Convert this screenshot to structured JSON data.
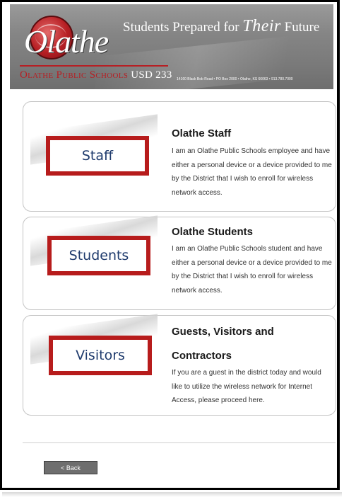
{
  "header": {
    "tagline_prefix": "Students Prepared for ",
    "tagline_script": "Their",
    "tagline_suffix": " Future",
    "logo_script": "Olathe",
    "logo_name_first": "Olathe Public Schools",
    "logo_name_second": " USD 233",
    "address": "14160 Black Bob Road • PO Box 2000 • Olathe, KS 66063 • 913.780.7000"
  },
  "options": [
    {
      "button_label": "Staff",
      "title": "Olathe Staff",
      "title_line2": "",
      "description": "I am an Olathe Public Schools employee and have either a personal device or a device provided to me by the District that I wish to enroll for wireless network access."
    },
    {
      "button_label": "Students",
      "title": "Olathe Students",
      "title_line2": "",
      "description": "I am an Olathe Public Schools student and have either a personal device or a device provided to me by the District that I wish to enroll for wireless network access."
    },
    {
      "button_label": "Visitors",
      "title": "Guests, Visitors and",
      "title_line2": "Contractors",
      "description": "If you are a guest in the district today and would like to utilize the wireless network for Internet Access, please proceed here."
    }
  ],
  "footer": {
    "back_label": "< Back"
  },
  "colors": {
    "highlight_border": "#b71c1c",
    "button_text": "#1f3b6d",
    "header_bg": "#858585"
  }
}
